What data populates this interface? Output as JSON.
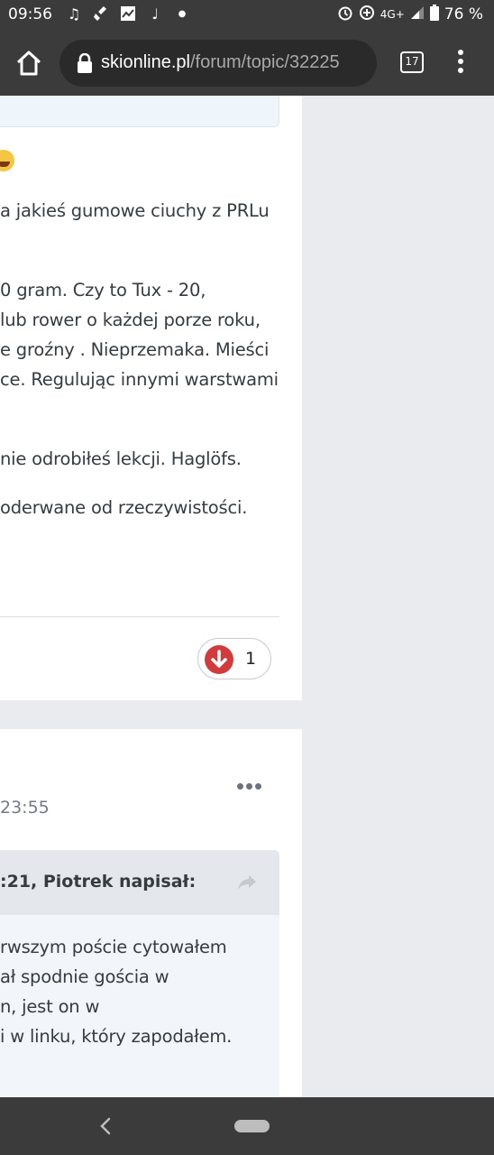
{
  "status_bar": {
    "time": "09:56",
    "network": "4G+",
    "battery": "76 %"
  },
  "browser": {
    "url_host": "skionline.pl",
    "url_path": "/forum/topic/32225",
    "tab_count": "17"
  },
  "post1": {
    "lines": [
      "a jakieś gumowe ciuchy z PRLu",
      "0 gram. Czy to Tux - 20,",
      " lub rower o każdej porze roku,",
      "e groźny . Nieprzemaka. Mieści",
      "ce. Regulując innymi warstwami",
      "nie odrobiłeś lekcji. Haglöfs.",
      " oderwane od rzeczywistości."
    ],
    "reaction_count": "1"
  },
  "post2": {
    "time": "23:55",
    "quote_author": ":21, Piotrek napisał:",
    "quote_lines": [
      "rwszym poście cytowałem",
      "ał spodnie gościa w",
      "n, jest on w",
      "i w linku, który zapodałem."
    ]
  },
  "colors": {
    "system_bar": "#3b3b3b",
    "downvote": "#d23b3b"
  }
}
